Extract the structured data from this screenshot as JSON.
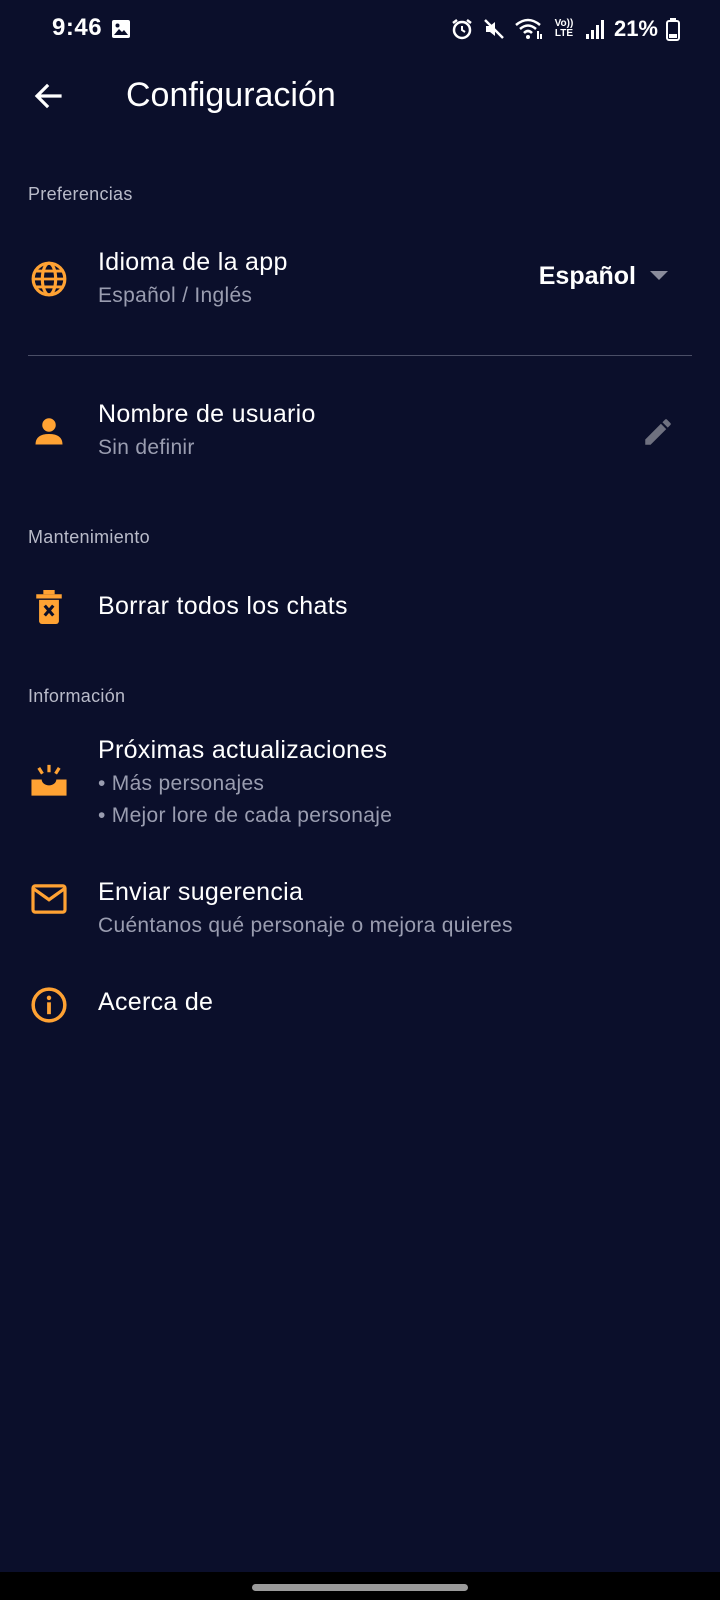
{
  "status_bar": {
    "time": "9:46",
    "battery_percent": "21%",
    "volte_label": "Vo)) LTE",
    "icons": [
      "gallery-icon",
      "alarm-icon",
      "mute-icon",
      "wifi-icon",
      "volte-icon",
      "signal-icon",
      "battery-icon"
    ]
  },
  "app_bar": {
    "title": "Configuración",
    "back_icon": "arrow-left-icon"
  },
  "sections": {
    "preferences": "Preferencias",
    "maintenance": "Mantenimiento",
    "information": "Información"
  },
  "items": {
    "language": {
      "title": "Idioma de la app",
      "subtitle": "Español / Inglés",
      "selected_value": "Español",
      "icon": "globe-icon"
    },
    "username": {
      "title": "Nombre de usuario",
      "subtitle": "Sin definir",
      "icon": "person-icon",
      "action_icon": "pencil-icon"
    },
    "clear_chats": {
      "title": "Borrar todos los chats",
      "icon": "delete-forever-icon"
    },
    "updates": {
      "title": "Próximas actualizaciones",
      "bullets": [
        "• Más personajes",
        "• Mejor lore de cada personaje"
      ],
      "icon": "upcoming-icon"
    },
    "suggestion": {
      "title": "Enviar sugerencia",
      "subtitle": "Cuéntanos qué personaje o mejora quieres",
      "icon": "mail-icon"
    },
    "about": {
      "title": "Acerca de",
      "icon": "info-icon"
    }
  },
  "colors": {
    "background": "#0b0f2b",
    "accent": "#ffa233",
    "text_primary": "#ffffff",
    "text_secondary": "#9a9db0",
    "section_header": "#b9bbc9",
    "divider": "#4a4e66"
  }
}
